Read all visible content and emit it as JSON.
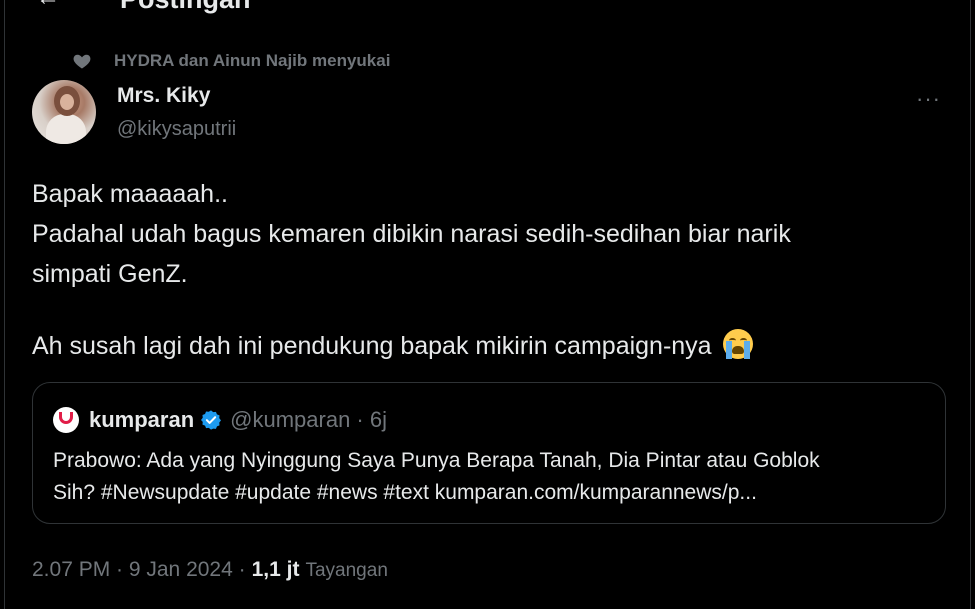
{
  "header": {
    "back_icon": "back-arrow-icon",
    "title": "Postingan"
  },
  "social_context": {
    "icon": "heart-icon",
    "text": "HYDRA dan Ainun Najib menyukai"
  },
  "author": {
    "display_name": "Mrs. Kiky",
    "handle": "@kikysaputrii",
    "avatar_icon": "avatar-photo"
  },
  "more_label": "···",
  "tweet": {
    "lines": [
      "Bapak maaaaah..",
      "Padahal udah bagus kemaren dibikin narasi sedih-sedihan biar narik",
      "simpati GenZ."
    ],
    "line_after_gap": "Ah susah lagi dah ini pendukung bapak mikirin campaign-nya",
    "emoji": "loudly-crying-face-icon"
  },
  "quote": {
    "logo_icon": "kumparan-logo-icon",
    "name": "kumparan",
    "verified_icon": "verified-badge-icon",
    "meta": "@kumparan · 6j",
    "lines": [
      "Prabowo: Ada yang Nyinggung Saya Punya Berapa Tanah, Dia Pintar atau Goblok",
      "Sih? #Newsupdate #update #news #text kumparan.com/kumparannews/p..."
    ]
  },
  "footer": {
    "timestamp": "2.07 PM · 9 Jan 2024 ·",
    "views_count": "1,1 jt",
    "views_label": "Tayangan"
  },
  "colors": {
    "background": "#000000",
    "text_primary": "#e7e9ea",
    "text_secondary": "#71767b",
    "border": "#2f3336",
    "verified_blue": "#1d9bf0",
    "kumparan_red": "#e11d48"
  }
}
